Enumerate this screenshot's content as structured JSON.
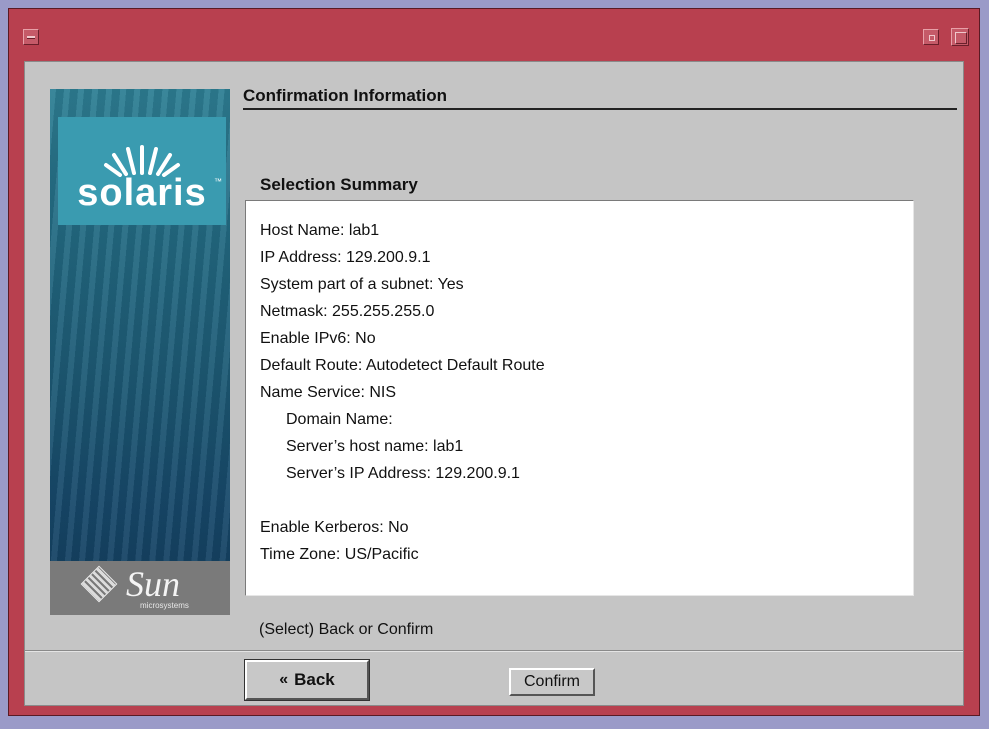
{
  "header": {
    "title": "Confirmation Information"
  },
  "banner": {
    "product": "solaris",
    "trademark": "™",
    "vendor": "Sun",
    "vendor_sub": "microsystems"
  },
  "summary": {
    "title": "Selection Summary",
    "lines": [
      "Host Name: lab1",
      "IP Address: 129.200.9.1",
      "System part of a subnet: Yes",
      "Netmask: 255.255.255.0",
      "Enable IPv6: No",
      "Default Route: Autodetect Default Route",
      "Name Service: NIS",
      "Domain Name:",
      "Server’s host name: lab1",
      "Server’s IP Address: 129.200.9.1",
      "Enable Kerberos: No",
      "Time Zone: US/Pacific"
    ]
  },
  "prompt": "(Select) Back or Confirm",
  "buttons": {
    "back": "Back",
    "confirm": "Confirm"
  },
  "icons": {
    "back": "double-chevron-left-icon"
  },
  "colors": {
    "frame": "#b8404f",
    "desktop": "#9a9ac8",
    "dialog": "#c5c5c5"
  }
}
